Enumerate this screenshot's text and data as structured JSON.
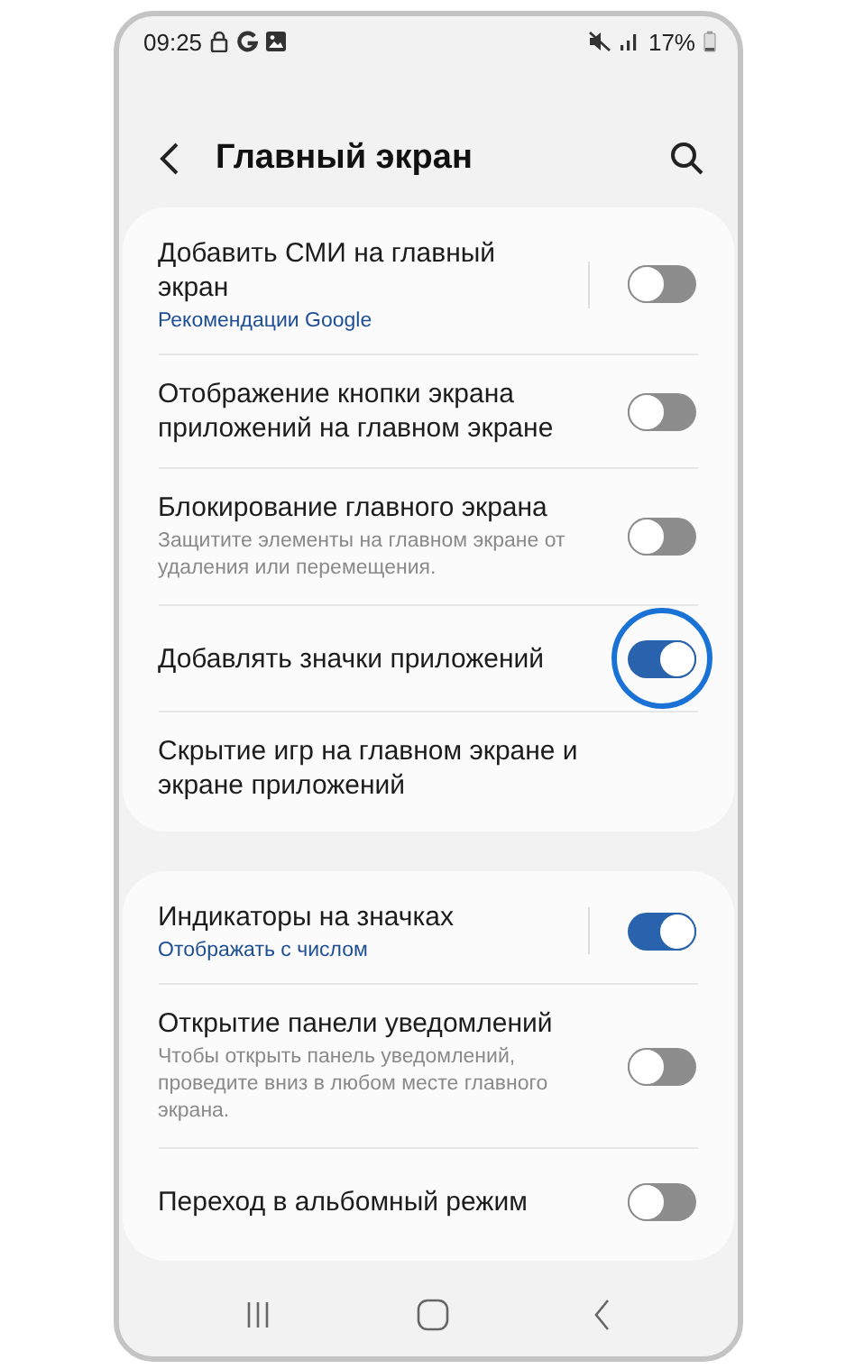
{
  "status_bar": {
    "time": "09:25",
    "battery": "17%"
  },
  "header": {
    "title": "Главный экран"
  },
  "sections": [
    {
      "items": [
        {
          "kind": "toggle",
          "title": "Добавить СМИ на главный экран",
          "summary": "Рекомендации Google",
          "split": true,
          "on": false,
          "highlighted": false
        },
        {
          "kind": "toggle",
          "title": "Отображение кнопки экрана приложений на главном экране",
          "split": false,
          "on": false,
          "highlighted": false
        },
        {
          "kind": "toggle",
          "title": "Блокирование главного экрана",
          "description": "Защитите элементы на главном экране от удаления или перемещения.",
          "split": false,
          "on": false,
          "highlighted": false
        },
        {
          "kind": "toggle",
          "title": "Добавлять значки приложений",
          "split": false,
          "on": true,
          "highlighted": true
        },
        {
          "kind": "link",
          "title": "Скрытие игр на главном экране и экране приложений"
        }
      ]
    },
    {
      "items": [
        {
          "kind": "toggle",
          "title": "Индикаторы на значках",
          "summary": "Отображать с числом",
          "split": true,
          "on": true,
          "highlighted": false
        },
        {
          "kind": "toggle",
          "title": "Открытие панели уведомлений",
          "description": "Чтобы открыть панель уведомлений, проведите вниз в любом месте главного экрана.",
          "split": false,
          "on": false,
          "highlighted": false
        },
        {
          "kind": "toggle",
          "title": "Переход в альбомный режим",
          "split": false,
          "on": false,
          "highlighted": false
        }
      ]
    }
  ]
}
